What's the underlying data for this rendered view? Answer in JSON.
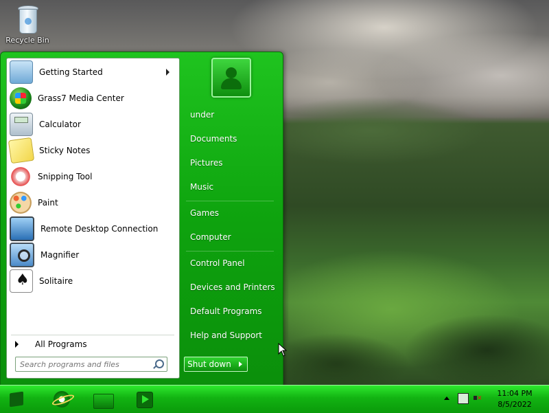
{
  "desktop": {
    "recycle_bin_label": "Recycle Bin"
  },
  "start_menu": {
    "programs": [
      {
        "label": "Getting Started",
        "icon": "getting-started-icon",
        "has_submenu": true
      },
      {
        "label": "Grass7 Media Center",
        "icon": "media-center-icon",
        "has_submenu": false
      },
      {
        "label": "Calculator",
        "icon": "calculator-icon",
        "has_submenu": false
      },
      {
        "label": "Sticky Notes",
        "icon": "sticky-notes-icon",
        "has_submenu": false
      },
      {
        "label": "Snipping Tool",
        "icon": "snipping-tool-icon",
        "has_submenu": false
      },
      {
        "label": "Paint",
        "icon": "paint-icon",
        "has_submenu": false
      },
      {
        "label": "Remote Desktop Connection",
        "icon": "remote-desktop-icon",
        "has_submenu": false
      },
      {
        "label": "Magnifier",
        "icon": "magnifier-icon",
        "has_submenu": false
      },
      {
        "label": "Solitaire",
        "icon": "solitaire-icon",
        "has_submenu": false
      }
    ],
    "all_programs_label": "All Programs",
    "search_placeholder": "Search programs and files",
    "right_links": [
      "under",
      "Documents",
      "Pictures",
      "Music",
      "Games",
      "Computer",
      "Control Panel",
      "Devices and Printers",
      "Default Programs",
      "Help and Support"
    ],
    "shutdown_label": "Shut down"
  },
  "taskbar": {
    "pinned": [
      "start-orb-icon",
      "internet-explorer-icon",
      "file-explorer-icon",
      "media-player-icon"
    ],
    "clock": {
      "time": "11:04 PM",
      "date": "8/5/2022"
    }
  },
  "colors": {
    "accent": "#12b312",
    "menu_bg": "#0ea30e"
  }
}
